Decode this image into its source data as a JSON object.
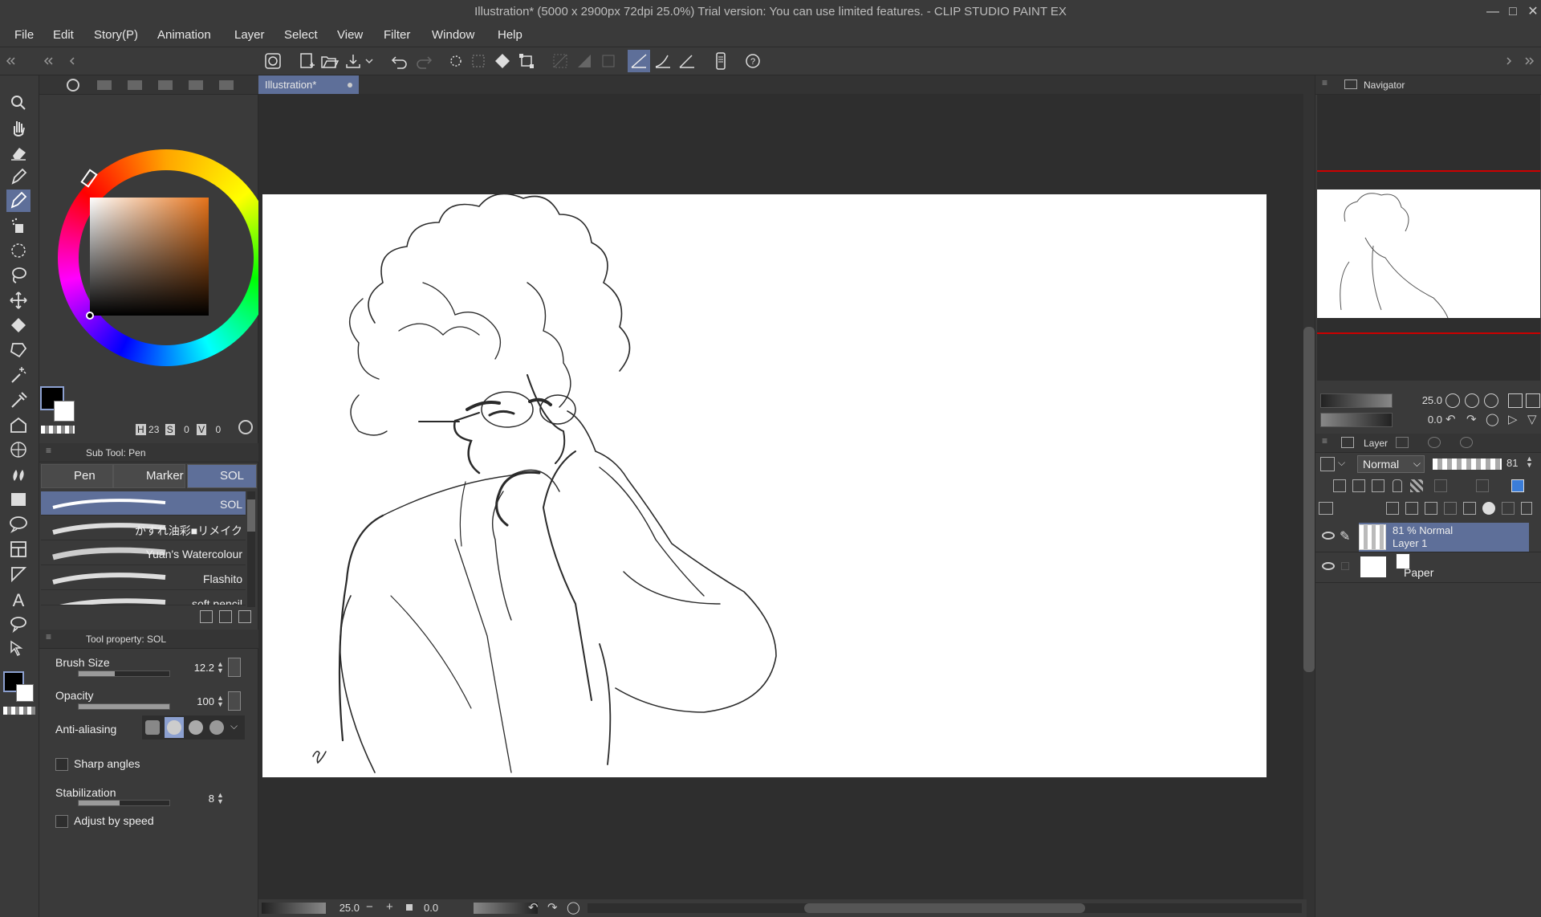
{
  "window": {
    "title": "Illustration* (5000 x 2900px 72dpi 25.0%)  Trial version: You can use limited features. - CLIP STUDIO PAINT EX",
    "minimize_icon": "minimize-icon",
    "maximize_icon": "maximize-icon",
    "close_icon": "close-icon"
  },
  "menu": [
    "File",
    "Edit",
    "Story(P)",
    "Animation",
    "Layer",
    "Select",
    "View",
    "Filter",
    "Window",
    "Help"
  ],
  "document_tab": "Illustration*",
  "color": {
    "H": "23",
    "S": "0",
    "V": "0",
    "foreground": "#000000",
    "background": "#ffffff"
  },
  "subtool": {
    "header": "Sub Tool: Pen",
    "tabs": [
      "Pen",
      "Marker",
      "SOL"
    ],
    "selected_tab": "SOL",
    "brushes": [
      "SOL",
      "かすれ油彩■リメイク",
      "Yuan's Watercolour",
      "Flashito",
      "soft pencil"
    ],
    "selected_brush": "SOL"
  },
  "tool_property": {
    "header": "Tool property: SOL",
    "brush_size_label": "Brush Size",
    "brush_size": "12.2",
    "opacity_label": "Opacity",
    "opacity": "100",
    "antialiasing_label": "Anti-aliasing",
    "sharp_angles_label": "Sharp angles",
    "stabilization_label": "Stabilization",
    "stabilization": "8",
    "adjust_by_speed_label": "Adjust by speed",
    "brush_size_level": 0.4,
    "opacity_level": 1.0,
    "stabilization_level": 0.45
  },
  "navigator": {
    "title": "Navigator",
    "zoom": "25.0",
    "rotation": "0.0"
  },
  "layer_panel": {
    "title": "Layer",
    "blend_mode": "Normal",
    "opacity": "81",
    "layers": [
      {
        "name": "Layer 1",
        "info": "81 % Normal",
        "selected": true
      },
      {
        "name": "Paper",
        "info": "",
        "selected": false
      }
    ]
  },
  "statusbar": {
    "zoom": "25.0",
    "rotation": "0.0"
  }
}
